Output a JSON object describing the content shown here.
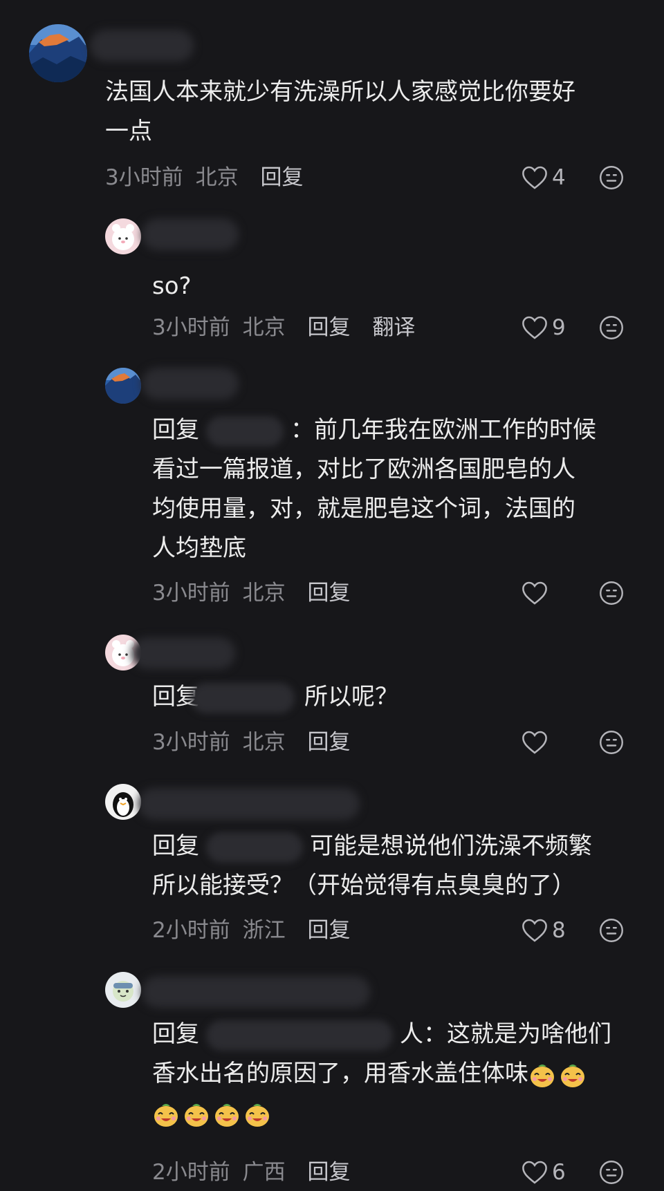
{
  "comments": [
    {
      "text": "法国人本来就少有洗澡所以人家感觉比你要好\n一点",
      "time": "3小时前",
      "location": "北京",
      "reply_label": "回复",
      "likes": "4"
    },
    {
      "text": "so?",
      "time": "3小时前",
      "location": "北京",
      "reply_label": "回复",
      "translate_label": "翻译",
      "likes": "9"
    },
    {
      "reply_prefix": "回复",
      "text_after": "：前几年我在欧洲工作的时候",
      "text_rest": "看过一篇报道，对比了欧洲各国肥皂的人\n均使用量，对，就是肥皂这个词，法国的\n人均垫底",
      "time": "3小时前",
      "location": "北京",
      "reply_label": "回复",
      "likes": ""
    },
    {
      "reply_prefix": "回复",
      "text_after": "所以呢？",
      "time": "3小时前",
      "location": "北京",
      "reply_label": "回复",
      "likes": ""
    },
    {
      "reply_prefix": "回复",
      "text_after": "可能是想说他们洗澡不频繁",
      "text_rest": "所以能接受？（开始觉得有点臭臭的了）",
      "time": "2小时前",
      "location": "浙江",
      "reply_label": "回复",
      "likes": "8"
    },
    {
      "reply_prefix": "回复",
      "text_after": "人：这就是为啥他们",
      "text_rest": "香水出名的原因了，用香水盖住体味",
      "emoji_name": "laughing-pudding-emoji",
      "time": "2小时前",
      "location": "广西",
      "reply_label": "回复",
      "likes": "6"
    }
  ],
  "colors": {
    "background": "#17171a",
    "text": "#ececec",
    "meta": "#8a8a8f"
  }
}
